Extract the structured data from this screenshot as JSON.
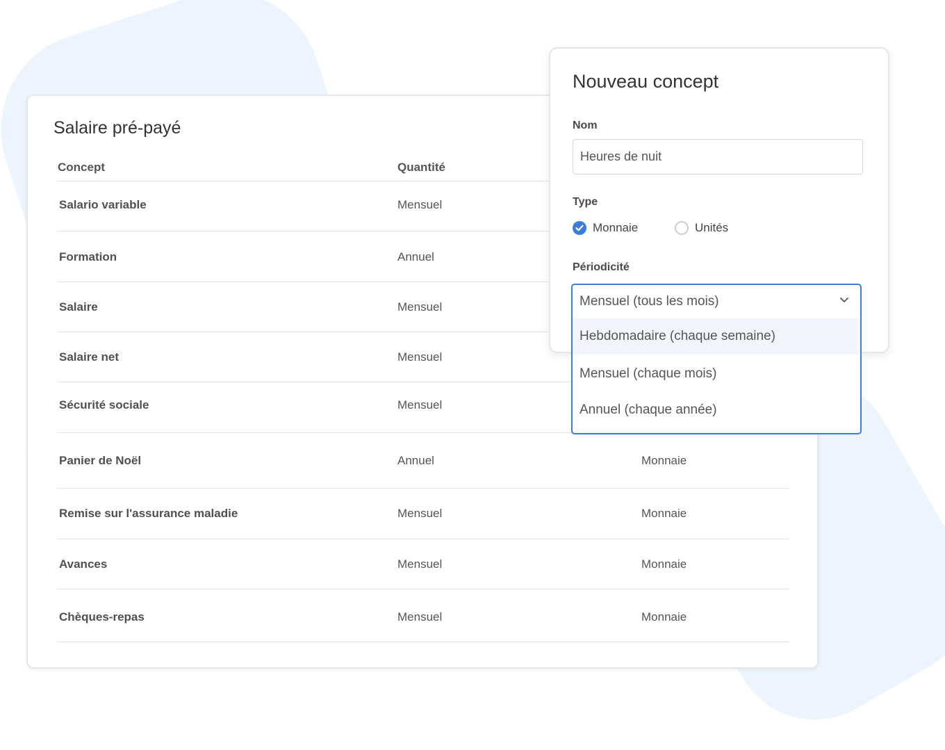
{
  "main_card": {
    "title": "Salaire pré-payé",
    "columns": {
      "concept": "Concept",
      "quantity": "Quantité"
    },
    "rows": [
      {
        "concept": "Salario variable",
        "quantity": "Mensuel",
        "type": ""
      },
      {
        "concept": "Formation",
        "quantity": "Annuel",
        "type": ""
      },
      {
        "concept": "Salaire",
        "quantity": "Mensuel",
        "type": ""
      },
      {
        "concept": "Salaire net",
        "quantity": "Mensuel",
        "type": ""
      },
      {
        "concept": "Sécurité sociale",
        "quantity": "Mensuel",
        "type": ""
      },
      {
        "concept": "Panier de Noël",
        "quantity": "Annuel",
        "type": "Monnaie"
      },
      {
        "concept": "Remise sur l'assurance maladie",
        "quantity": "Mensuel",
        "type": "Monnaie"
      },
      {
        "concept": "Avances",
        "quantity": "Mensuel",
        "type": "Monnaie"
      },
      {
        "concept": "Chèques-repas",
        "quantity": "Mensuel",
        "type": "Monnaie"
      }
    ]
  },
  "popup": {
    "title": "Nouveau concept",
    "name_label": "Nom",
    "name_value": "Heures de nuit",
    "type_label": "Type",
    "type_options": [
      {
        "label": "Monnaie",
        "checked": true
      },
      {
        "label": "Unités",
        "checked": false
      }
    ],
    "periodicity_label": "Périodicité",
    "periodicity_selected": "Mensuel (tous les mois)",
    "periodicity_options": [
      "Hebdomadaire (chaque semaine)",
      "Mensuel (chaque mois)",
      "Annuel (chaque année)"
    ]
  },
  "colors": {
    "accent": "#3b7ddd",
    "background_shape": "#eef4fd",
    "highlight": "#f2f6fc"
  },
  "icons": {
    "radio_checked": "check-icon",
    "dropdown": "chevron-down-icon"
  }
}
